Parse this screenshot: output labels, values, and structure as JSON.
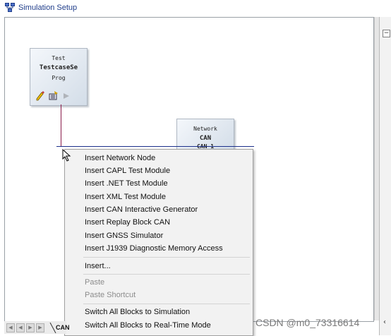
{
  "window": {
    "title": "Simulation Setup"
  },
  "blocks": {
    "test": {
      "type": "Test",
      "name": "TestcaseSe",
      "sub": "Prog"
    },
    "network": {
      "type": "Network",
      "name": "CAN",
      "sub": "CAN 1"
    }
  },
  "context_menu": {
    "items": [
      {
        "label": "Insert Network Node",
        "enabled": true
      },
      {
        "label": "Insert CAPL Test Module",
        "enabled": true
      },
      {
        "label": "Insert .NET Test Module",
        "enabled": true
      },
      {
        "label": "Insert XML Test Module",
        "enabled": true
      },
      {
        "label": "Insert CAN Interactive Generator",
        "enabled": true
      },
      {
        "label": "Insert Replay Block CAN",
        "enabled": true
      },
      {
        "label": "Insert GNSS Simulator",
        "enabled": true
      },
      {
        "label": "Insert J1939 Diagnostic Memory Access",
        "enabled": true
      },
      {
        "label": "Insert...",
        "enabled": true
      },
      {
        "label": "Paste",
        "enabled": false
      },
      {
        "label": "Paste Shortcut",
        "enabled": false
      },
      {
        "label": "Switch All Blocks to Simulation",
        "enabled": true
      },
      {
        "label": "Switch All Blocks to Real-Time Mode",
        "enabled": true
      }
    ]
  },
  "tabs": {
    "active_label": "CAN"
  },
  "icons": {
    "title": "simulation-setup-icon",
    "edit": "pencil-icon",
    "config": "config-icon",
    "run": "play-icon",
    "collapse": "collapse-icon"
  },
  "watermark": "CSDN @m0_73316614",
  "right_panel": {
    "collapse_symbol": "−"
  },
  "colors": {
    "title_text": "#1f3d8a",
    "vertical_line": "#8a1b4a",
    "bus_line": "#1b2f8a",
    "menu_bg": "#f2f2f2",
    "disabled_text": "#8c8c8c"
  }
}
